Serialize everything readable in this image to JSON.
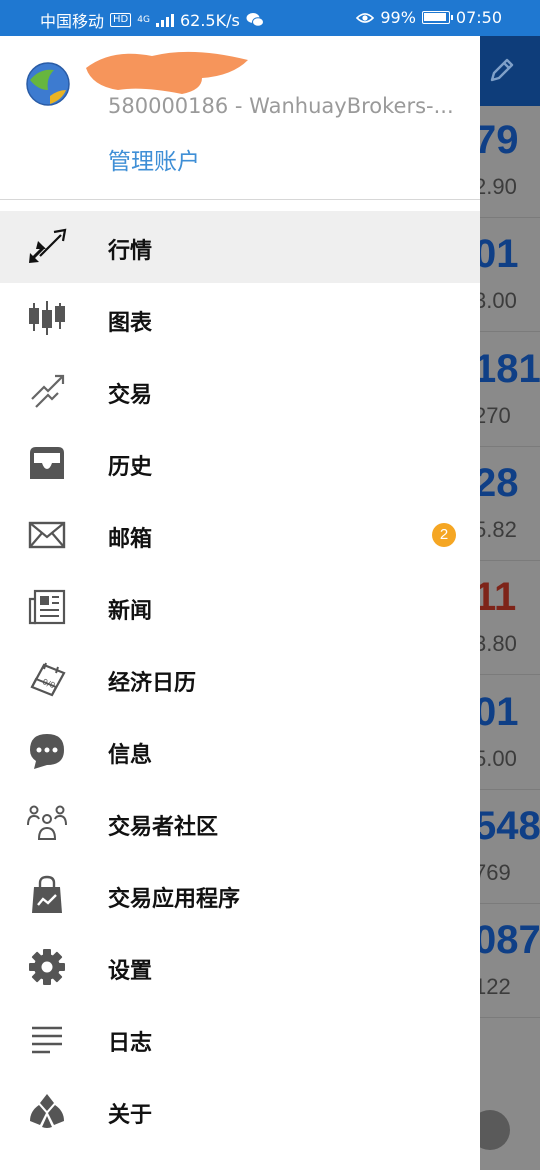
{
  "status_bar": {
    "carrier": "中国移动",
    "hd": "HD",
    "network": "4G",
    "speed": "62.5K/s",
    "battery": "99%",
    "time": "07:50"
  },
  "account": {
    "number": "580000186 - WanhuayBrokers-...",
    "manage_label": "管理账户"
  },
  "menu": {
    "items": [
      {
        "label": "行情",
        "icon": "quotes-arrows-icon"
      },
      {
        "label": "图表",
        "icon": "candlestick-chart-icon"
      },
      {
        "label": "交易",
        "icon": "trade-trend-icon"
      },
      {
        "label": "历史",
        "icon": "history-inbox-icon"
      },
      {
        "label": "邮箱",
        "icon": "mail-envelope-icon",
        "badge": "2"
      },
      {
        "label": "新闻",
        "icon": "news-paper-icon"
      },
      {
        "label": "经济日历",
        "icon": "calendar-icon"
      },
      {
        "label": "信息",
        "icon": "chat-bubble-icon"
      },
      {
        "label": "交易者社区",
        "icon": "community-people-icon"
      },
      {
        "label": "交易应用程序",
        "icon": "app-bag-icon"
      },
      {
        "label": "设置",
        "icon": "gear-icon"
      },
      {
        "label": "日志",
        "icon": "journal-lines-icon"
      },
      {
        "label": "关于",
        "icon": "about-logo-icon"
      }
    ]
  },
  "background_quotes": [
    {
      "big": "79",
      "small": "2.90",
      "color": "blue"
    },
    {
      "big": "01",
      "small": "3.00",
      "color": "blue"
    },
    {
      "big": "181",
      "small": "270",
      "color": "blue"
    },
    {
      "big": "28",
      "small": "5.82",
      "color": "blue"
    },
    {
      "big": "11",
      "small": "3.80",
      "color": "red"
    },
    {
      "big": "01",
      "small": "5.00",
      "color": "blue"
    },
    {
      "big": "548",
      "small": "769",
      "color": "blue"
    },
    {
      "big": "087",
      "small": "122",
      "color": "blue"
    }
  ],
  "colors": {
    "status_bar": "#1f78d1",
    "accent_link": "#3f8fd6",
    "badge": "#f5a623",
    "active_row": "#efefef"
  }
}
